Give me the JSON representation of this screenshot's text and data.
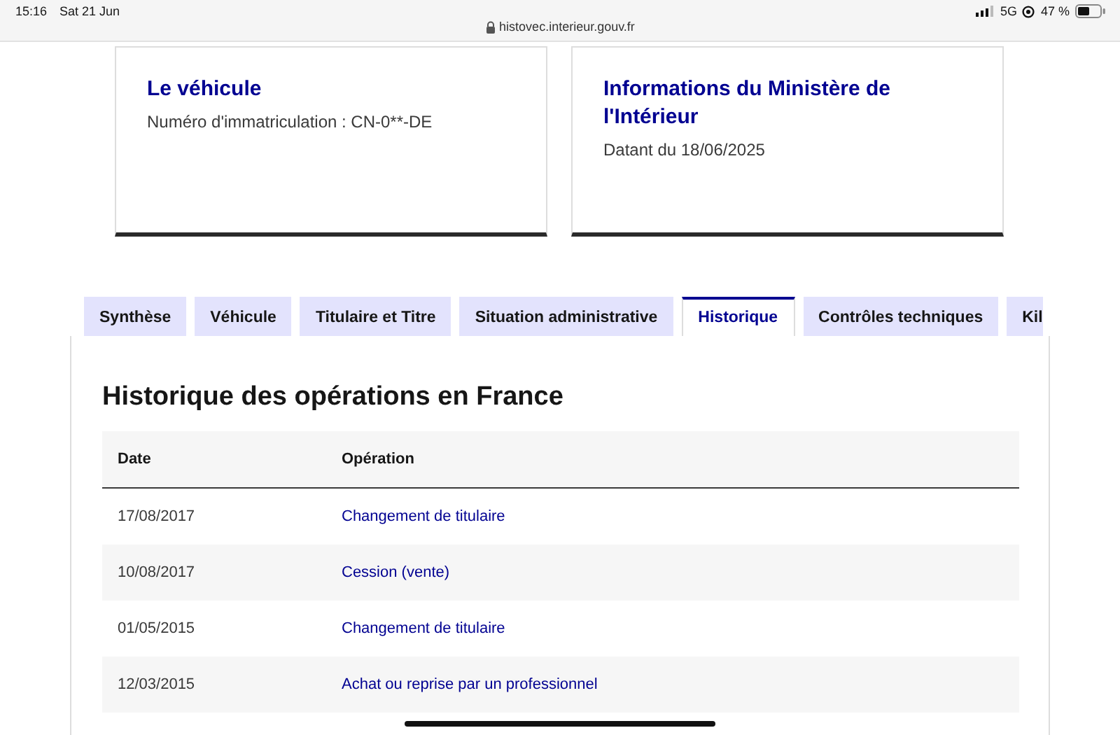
{
  "status_bar": {
    "time": "15:16",
    "date": "Sat 21 Jun",
    "network": "5G",
    "battery": "47 %"
  },
  "address_bar": {
    "url": "histovec.interieur.gouv.fr"
  },
  "cards": [
    {
      "title": "Le véhicule",
      "text": "Numéro d'immatriculation : CN-0**-DE"
    },
    {
      "title": "Informations du Ministère de l'Intérieur",
      "text": "Datant du 18/06/2025"
    }
  ],
  "tabs": [
    {
      "label": "Synthèse",
      "selected": false
    },
    {
      "label": "Véhicule",
      "selected": false
    },
    {
      "label": "Titulaire et Titre",
      "selected": false
    },
    {
      "label": "Situation administrative",
      "selected": false
    },
    {
      "label": "Historique",
      "selected": true
    },
    {
      "label": "Contrôles techniques",
      "selected": false
    },
    {
      "label": "Kil",
      "selected": false
    }
  ],
  "panel": {
    "heading": "Historique des opérations en France",
    "table": {
      "columns": [
        "Date",
        "Opération"
      ],
      "rows": [
        {
          "date": "17/08/2017",
          "operation": "Changement de titulaire"
        },
        {
          "date": "10/08/2017",
          "operation": "Cession (vente)"
        },
        {
          "date": "01/05/2015",
          "operation": "Changement de titulaire"
        },
        {
          "date": "12/03/2015",
          "operation": "Achat ou reprise par un professionnel"
        }
      ]
    }
  }
}
